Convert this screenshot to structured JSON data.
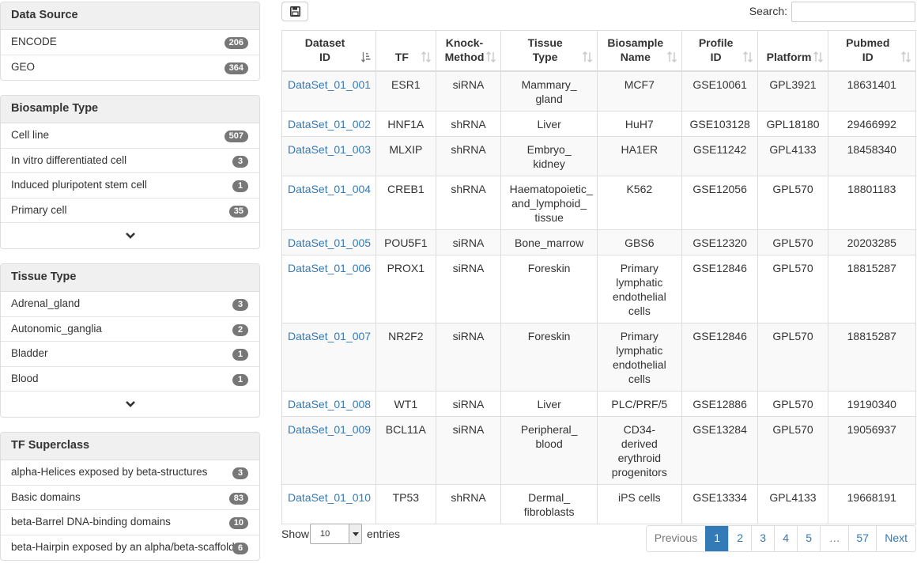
{
  "sidebar": {
    "data_source": {
      "title": "Data Source",
      "items": [
        {
          "label": "ENCODE",
          "count": "206"
        },
        {
          "label": "GEO",
          "count": "364"
        }
      ]
    },
    "biosample_type": {
      "title": "Biosample Type",
      "items": [
        {
          "label": "Cell line",
          "count": "507"
        },
        {
          "label": "In vitro differentiated cell",
          "count": "3"
        },
        {
          "label": "Induced pluripotent stem cell",
          "count": "1"
        },
        {
          "label": "Primary cell",
          "count": "35"
        }
      ]
    },
    "tissue_type": {
      "title": "Tissue Type",
      "items": [
        {
          "label": "Adrenal_gland",
          "count": "3"
        },
        {
          "label": "Autonomic_ganglia",
          "count": "2"
        },
        {
          "label": "Bladder",
          "count": "1"
        },
        {
          "label": "Blood",
          "count": "1"
        }
      ]
    },
    "tf_superclass": {
      "title": "TF Superclass",
      "items": [
        {
          "label": "alpha-Helices exposed by beta-structures",
          "count": "3"
        },
        {
          "label": "Basic domains",
          "count": "83"
        },
        {
          "label": "beta-Barrel DNA-binding domains",
          "count": "10"
        },
        {
          "label": "beta-Hairpin exposed by an alpha/beta-scaffold",
          "count": "6"
        }
      ]
    }
  },
  "toolbar": {
    "search_label": "Search:",
    "search_value": ""
  },
  "table": {
    "headers": [
      "Dataset ID",
      "TF",
      "Knock-Method",
      "Tissue Type",
      "Biosample Name",
      "Profile ID",
      "Platform",
      "Pubmed ID"
    ],
    "rows": [
      [
        "DataSet_01_001",
        "ESR1",
        "siRNA",
        "Mammary_ gland",
        "MCF7",
        "GSE10061",
        "GPL3921",
        "18631401"
      ],
      [
        "DataSet_01_002",
        "HNF1A",
        "shRNA",
        "Liver",
        "HuH7",
        "GSE103128",
        "GPL18180",
        "29466992"
      ],
      [
        "DataSet_01_003",
        "MLXIP",
        "shRNA",
        "Embryo_ kidney",
        "HA1ER",
        "GSE11242",
        "GPL4133",
        "18458340"
      ],
      [
        "DataSet_01_004",
        "CREB1",
        "shRNA",
        "Haematopoietic_ and_lymphoid_ tissue",
        "K562",
        "GSE12056",
        "GPL570",
        "18801183"
      ],
      [
        "DataSet_01_005",
        "POU5F1",
        "siRNA",
        "Bone_marrow",
        "GBS6",
        "GSE12320",
        "GPL570",
        "20203285"
      ],
      [
        "DataSet_01_006",
        "PROX1",
        "siRNA",
        "Foreskin",
        "Primary lymphatic endothelial cells",
        "GSE12846",
        "GPL570",
        "18815287"
      ],
      [
        "DataSet_01_007",
        "NR2F2",
        "siRNA",
        "Foreskin",
        "Primary lymphatic endothelial cells",
        "GSE12846",
        "GPL570",
        "18815287"
      ],
      [
        "DataSet_01_008",
        "WT1",
        "siRNA",
        "Liver",
        "PLC/PRF/5",
        "GSE12886",
        "GPL570",
        "19190340"
      ],
      [
        "DataSet_01_009",
        "BCL11A",
        "siRNA",
        "Peripheral_ blood",
        "CD34-derived erythroid progenitors",
        "GSE13284",
        "GPL570",
        "19056937"
      ],
      [
        "DataSet_01_010",
        "TP53",
        "shRNA",
        "Dermal_ fibroblasts",
        "iPS cells",
        "GSE13334",
        "GPL4133",
        "19668191"
      ]
    ]
  },
  "footer": {
    "show_label": "Show",
    "length_value": "10",
    "entries_label": "entries",
    "pagination": {
      "previous": "Previous",
      "pages": [
        "1",
        "2",
        "3",
        "4",
        "5"
      ],
      "ellipsis": "…",
      "last": "57",
      "next": "Next",
      "current": "1"
    }
  },
  "colors": {
    "link": "#337ab7",
    "badge": "#777777",
    "active_page": "#337ab7"
  }
}
